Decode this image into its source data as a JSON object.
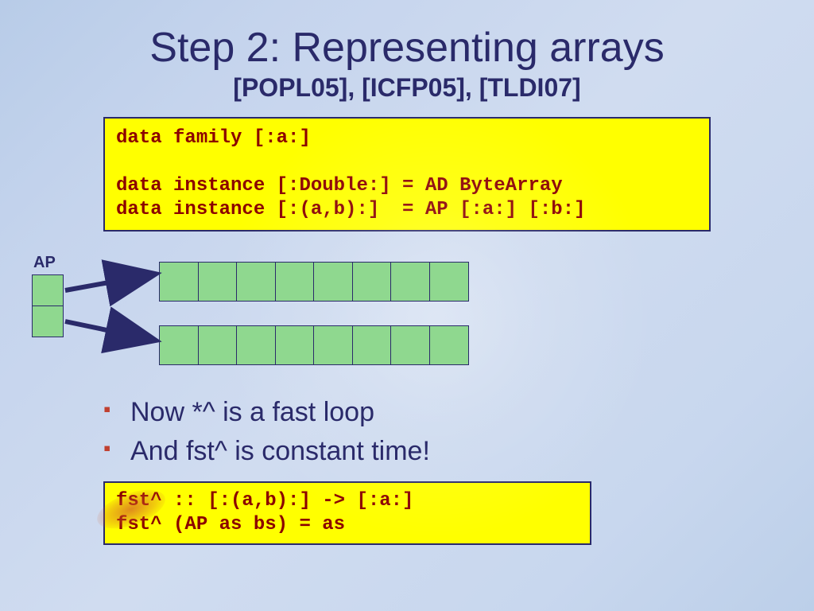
{
  "title": "Step 2: Representing arrays",
  "subtitle": "[POPL05], [ICFP05], [TLDI07]",
  "code1": "data family [:a:]\n\ndata instance [:Double:] = AD ByteArray\ndata instance [:(a,b):]  = AP [:a:] [:b:]",
  "diagram": {
    "label": "AP",
    "row_cells": 8
  },
  "bullets": [
    "Now *^ is a fast loop",
    "And fst^ is constant time!"
  ],
  "code2": "fst^ :: [:(a,b):] -> [:a:]\nfst^ (AP as bs) = as"
}
